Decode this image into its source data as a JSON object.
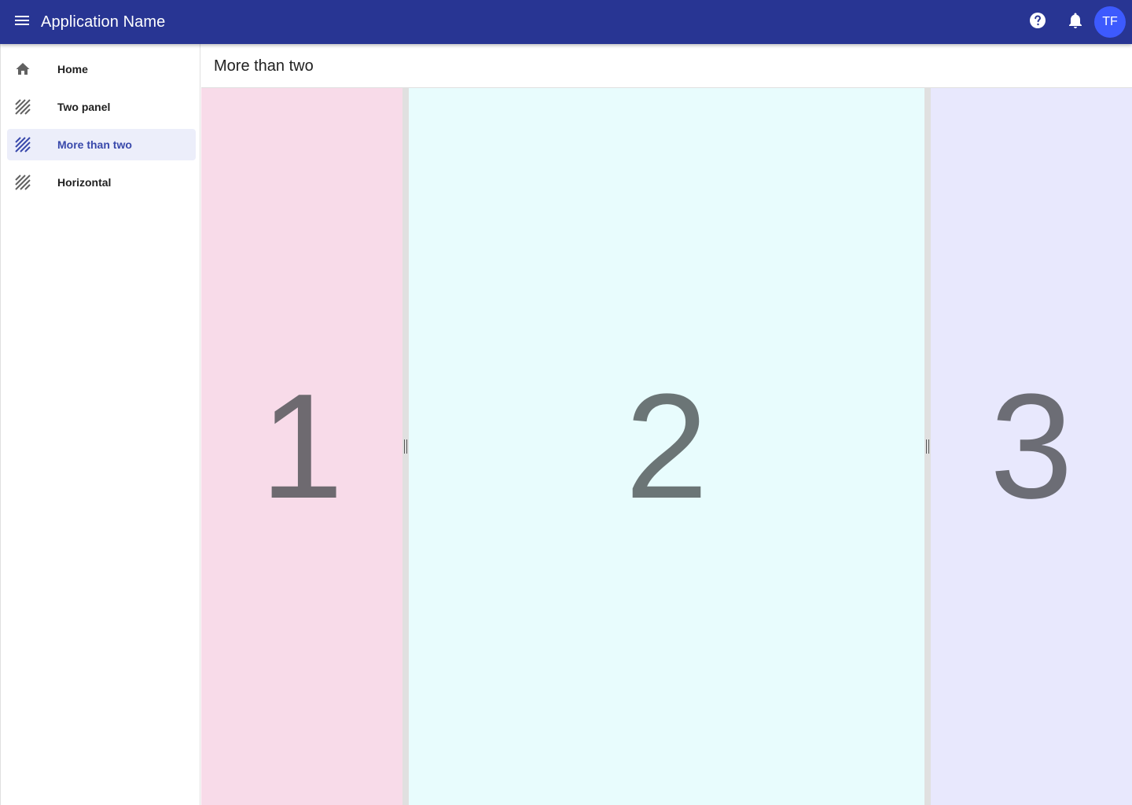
{
  "appbar": {
    "title": "Application Name",
    "avatar_initials": "TF",
    "icons": {
      "menu": "menu-icon",
      "help": "help-icon",
      "notifications": "bell-icon"
    }
  },
  "sidebar": {
    "items": [
      {
        "label": "Home",
        "icon": "home-icon",
        "active": false
      },
      {
        "label": "Two panel",
        "icon": "hatch-icon",
        "active": false
      },
      {
        "label": "More than two",
        "icon": "hatch-icon",
        "active": true
      },
      {
        "label": "Horizontal",
        "icon": "hatch-icon",
        "active": false
      }
    ]
  },
  "page": {
    "title": "More than two"
  },
  "panels": [
    {
      "label": "1",
      "background": "#f8dbe9",
      "text_color": "#6e6a70"
    },
    {
      "label": "2",
      "background": "#e8fcfd",
      "text_color": "#6b7576"
    },
    {
      "label": "3",
      "background": "#e8e8fd",
      "text_color": "#6c6d75"
    }
  ],
  "colors": {
    "appbar": "#283593",
    "accent": "#3949ab",
    "avatar": "#3d5afe",
    "active_nav_bg": "#eceefa"
  }
}
